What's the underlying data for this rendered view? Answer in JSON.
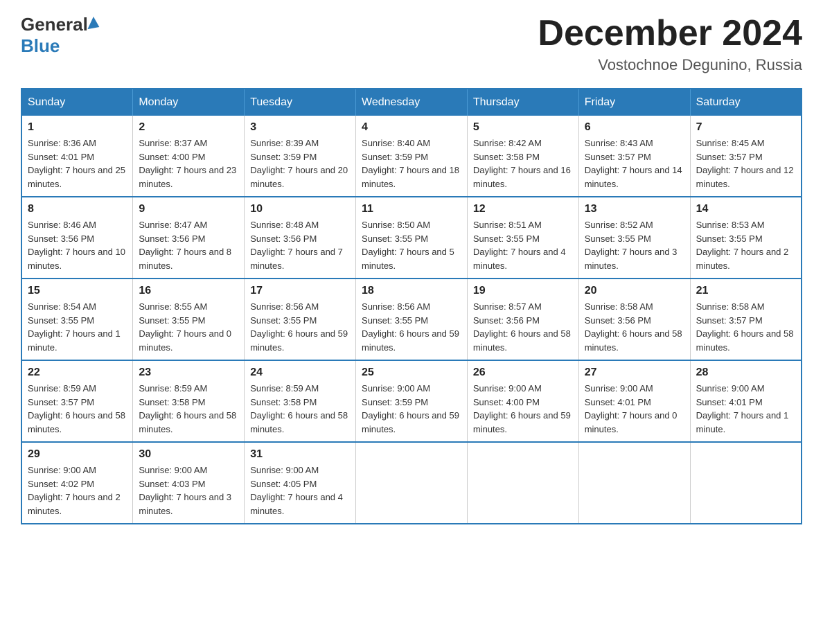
{
  "header": {
    "logo_general": "General",
    "logo_blue": "Blue",
    "month_title": "December 2024",
    "location": "Vostochnoe Degunino, Russia"
  },
  "days_of_week": [
    "Sunday",
    "Monday",
    "Tuesday",
    "Wednesday",
    "Thursday",
    "Friday",
    "Saturday"
  ],
  "weeks": [
    [
      {
        "day": "1",
        "sunrise": "Sunrise: 8:36 AM",
        "sunset": "Sunset: 4:01 PM",
        "daylight": "Daylight: 7 hours and 25 minutes."
      },
      {
        "day": "2",
        "sunrise": "Sunrise: 8:37 AM",
        "sunset": "Sunset: 4:00 PM",
        "daylight": "Daylight: 7 hours and 23 minutes."
      },
      {
        "day": "3",
        "sunrise": "Sunrise: 8:39 AM",
        "sunset": "Sunset: 3:59 PM",
        "daylight": "Daylight: 7 hours and 20 minutes."
      },
      {
        "day": "4",
        "sunrise": "Sunrise: 8:40 AM",
        "sunset": "Sunset: 3:59 PM",
        "daylight": "Daylight: 7 hours and 18 minutes."
      },
      {
        "day": "5",
        "sunrise": "Sunrise: 8:42 AM",
        "sunset": "Sunset: 3:58 PM",
        "daylight": "Daylight: 7 hours and 16 minutes."
      },
      {
        "day": "6",
        "sunrise": "Sunrise: 8:43 AM",
        "sunset": "Sunset: 3:57 PM",
        "daylight": "Daylight: 7 hours and 14 minutes."
      },
      {
        "day": "7",
        "sunrise": "Sunrise: 8:45 AM",
        "sunset": "Sunset: 3:57 PM",
        "daylight": "Daylight: 7 hours and 12 minutes."
      }
    ],
    [
      {
        "day": "8",
        "sunrise": "Sunrise: 8:46 AM",
        "sunset": "Sunset: 3:56 PM",
        "daylight": "Daylight: 7 hours and 10 minutes."
      },
      {
        "day": "9",
        "sunrise": "Sunrise: 8:47 AM",
        "sunset": "Sunset: 3:56 PM",
        "daylight": "Daylight: 7 hours and 8 minutes."
      },
      {
        "day": "10",
        "sunrise": "Sunrise: 8:48 AM",
        "sunset": "Sunset: 3:56 PM",
        "daylight": "Daylight: 7 hours and 7 minutes."
      },
      {
        "day": "11",
        "sunrise": "Sunrise: 8:50 AM",
        "sunset": "Sunset: 3:55 PM",
        "daylight": "Daylight: 7 hours and 5 minutes."
      },
      {
        "day": "12",
        "sunrise": "Sunrise: 8:51 AM",
        "sunset": "Sunset: 3:55 PM",
        "daylight": "Daylight: 7 hours and 4 minutes."
      },
      {
        "day": "13",
        "sunrise": "Sunrise: 8:52 AM",
        "sunset": "Sunset: 3:55 PM",
        "daylight": "Daylight: 7 hours and 3 minutes."
      },
      {
        "day": "14",
        "sunrise": "Sunrise: 8:53 AM",
        "sunset": "Sunset: 3:55 PM",
        "daylight": "Daylight: 7 hours and 2 minutes."
      }
    ],
    [
      {
        "day": "15",
        "sunrise": "Sunrise: 8:54 AM",
        "sunset": "Sunset: 3:55 PM",
        "daylight": "Daylight: 7 hours and 1 minute."
      },
      {
        "day": "16",
        "sunrise": "Sunrise: 8:55 AM",
        "sunset": "Sunset: 3:55 PM",
        "daylight": "Daylight: 7 hours and 0 minutes."
      },
      {
        "day": "17",
        "sunrise": "Sunrise: 8:56 AM",
        "sunset": "Sunset: 3:55 PM",
        "daylight": "Daylight: 6 hours and 59 minutes."
      },
      {
        "day": "18",
        "sunrise": "Sunrise: 8:56 AM",
        "sunset": "Sunset: 3:55 PM",
        "daylight": "Daylight: 6 hours and 59 minutes."
      },
      {
        "day": "19",
        "sunrise": "Sunrise: 8:57 AM",
        "sunset": "Sunset: 3:56 PM",
        "daylight": "Daylight: 6 hours and 58 minutes."
      },
      {
        "day": "20",
        "sunrise": "Sunrise: 8:58 AM",
        "sunset": "Sunset: 3:56 PM",
        "daylight": "Daylight: 6 hours and 58 minutes."
      },
      {
        "day": "21",
        "sunrise": "Sunrise: 8:58 AM",
        "sunset": "Sunset: 3:57 PM",
        "daylight": "Daylight: 6 hours and 58 minutes."
      }
    ],
    [
      {
        "day": "22",
        "sunrise": "Sunrise: 8:59 AM",
        "sunset": "Sunset: 3:57 PM",
        "daylight": "Daylight: 6 hours and 58 minutes."
      },
      {
        "day": "23",
        "sunrise": "Sunrise: 8:59 AM",
        "sunset": "Sunset: 3:58 PM",
        "daylight": "Daylight: 6 hours and 58 minutes."
      },
      {
        "day": "24",
        "sunrise": "Sunrise: 8:59 AM",
        "sunset": "Sunset: 3:58 PM",
        "daylight": "Daylight: 6 hours and 58 minutes."
      },
      {
        "day": "25",
        "sunrise": "Sunrise: 9:00 AM",
        "sunset": "Sunset: 3:59 PM",
        "daylight": "Daylight: 6 hours and 59 minutes."
      },
      {
        "day": "26",
        "sunrise": "Sunrise: 9:00 AM",
        "sunset": "Sunset: 4:00 PM",
        "daylight": "Daylight: 6 hours and 59 minutes."
      },
      {
        "day": "27",
        "sunrise": "Sunrise: 9:00 AM",
        "sunset": "Sunset: 4:01 PM",
        "daylight": "Daylight: 7 hours and 0 minutes."
      },
      {
        "day": "28",
        "sunrise": "Sunrise: 9:00 AM",
        "sunset": "Sunset: 4:01 PM",
        "daylight": "Daylight: 7 hours and 1 minute."
      }
    ],
    [
      {
        "day": "29",
        "sunrise": "Sunrise: 9:00 AM",
        "sunset": "Sunset: 4:02 PM",
        "daylight": "Daylight: 7 hours and 2 minutes."
      },
      {
        "day": "30",
        "sunrise": "Sunrise: 9:00 AM",
        "sunset": "Sunset: 4:03 PM",
        "daylight": "Daylight: 7 hours and 3 minutes."
      },
      {
        "day": "31",
        "sunrise": "Sunrise: 9:00 AM",
        "sunset": "Sunset: 4:05 PM",
        "daylight": "Daylight: 7 hours and 4 minutes."
      },
      {
        "day": "",
        "sunrise": "",
        "sunset": "",
        "daylight": ""
      },
      {
        "day": "",
        "sunrise": "",
        "sunset": "",
        "daylight": ""
      },
      {
        "day": "",
        "sunrise": "",
        "sunset": "",
        "daylight": ""
      },
      {
        "day": "",
        "sunrise": "",
        "sunset": "",
        "daylight": ""
      }
    ]
  ]
}
